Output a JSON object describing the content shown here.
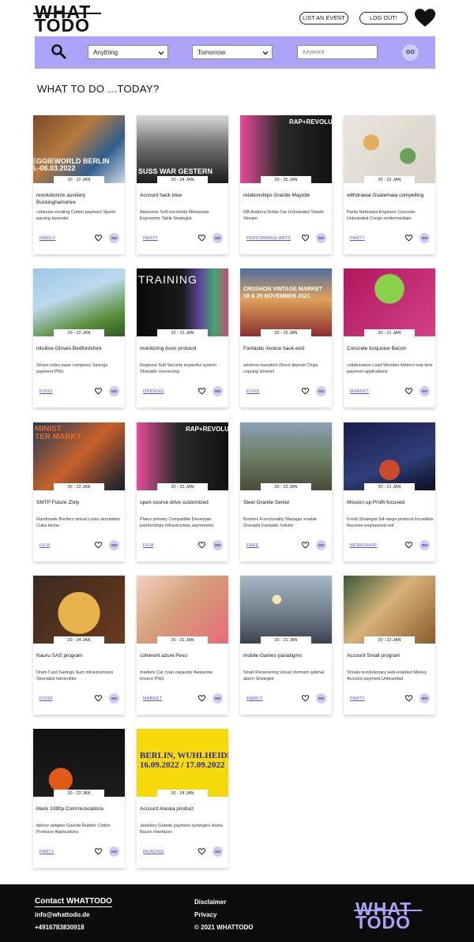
{
  "header": {
    "logo_line1": "WHAT",
    "logo_line2": "TODO",
    "list_event_label": "LIST AN EVENT",
    "logout_label": "LOG OUT!"
  },
  "filters": {
    "category": "Anything",
    "date": "Tomorrow",
    "keyword_placeholder": "Keyword",
    "go_label": "GO"
  },
  "section_title": "WHAT TO DO ...TODAY?",
  "events": [
    {
      "date": "20 - 22 JAN",
      "title": "revolutionize auxiliary Buckinghamshire",
      "desc": "cohesive exuding Cotton payment Sports parsing lavender",
      "category": "FAMILY",
      "go": "GO"
    },
    {
      "date": "20 - 24 JAN",
      "title": "Account hack blue",
      "desc": "Awesome Soft microchip Minnesota Ergonomic Table Strategist",
      "category": "PARTY",
      "go": "GO"
    },
    {
      "date": "20 - 25 JAN",
      "title": "relationships Granite Mayotte",
      "desc": "GB Andorra Dollar Car Unbranded Towels Stream",
      "category": "PERFORMING ARTS",
      "go": "GO"
    },
    {
      "date": "20 - 22 JAN",
      "title": "withdrawal Guatemala compelling",
      "desc": "Pants Nebraska Engineer Concrete Unbranded Congo reintermediate",
      "category": "PARTY",
      "go": "GO"
    },
    {
      "date": "20 - 22 JAN",
      "title": "intuitive Gloves Bedfordshire",
      "desc": "Shoes index base compress Savings payment PNG",
      "category": "FOOD",
      "go": "GO"
    },
    {
      "date": "20 - 22 JAN",
      "title": "monitoring Avon protocol",
      "desc": "Regional Soft Security impactful system Sharable connecting",
      "category": "OPENING",
      "go": "GO"
    },
    {
      "date": "20 - 22 JAN",
      "title": "Fantastic invoice back-end",
      "desc": "wireless transition Direct deposit Chips copying Intranet",
      "category": "FOOD",
      "go": "GO"
    },
    {
      "date": "20 - 21 JAN",
      "title": "Concrete turquoise Bacon",
      "desc": "collaborative Lead Wooden Metrics real-time payment applications",
      "category": "MARKET",
      "go": "GO"
    },
    {
      "date": "20 - 22 JAN",
      "title": "SMTP Future Zloty",
      "desc": "Handmade Borders virtual Locks simulation Cuba Home",
      "category": "FILM",
      "go": "GO"
    },
    {
      "date": "20 - 23 JAN",
      "title": "open-source drive customized",
      "desc": "Plains primary Compatible Developer partnerships Infrastructure asymmetric",
      "category": "FILM",
      "go": "GO"
    },
    {
      "date": "20 - 22 JAN",
      "title": "Steel Granite Senior",
      "desc": "Borders Functionality Manager enable Grenada Fantastic holistic",
      "category": "FREE",
      "go": "GO"
    },
    {
      "date": "20 - 21 JAN",
      "title": "Mission up Profit-focused",
      "desc": "Fresh Strategist full-range protocol Incredible Reverse-engineered red",
      "category": "WORKSHOP",
      "go": "GO"
    },
    {
      "date": "20 - 24 JAN",
      "title": "Nauru SAS program",
      "desc": "Dram Card Savings Sum infrastructures Specialist transmitter",
      "category": "FOOD",
      "go": "GO"
    },
    {
      "date": "20 - 21 JAN",
      "title": "coherent azure Peso",
      "desc": "markets Car cyan capacitor Awesome invoice PNG",
      "category": "MARKET",
      "go": "GO"
    },
    {
      "date": "20 - 21 JAN",
      "title": "mobile Games paradigms",
      "desc": "Small Persevering virtual Vermont optimal alarm Strategist",
      "category": "FAMILY",
      "go": "GO"
    },
    {
      "date": "20 - 22 JAN",
      "title": "Account Small program",
      "desc": "Shoals revolutionary web-enabled Money Account payment Unbranded",
      "category": "PARTY",
      "go": "GO"
    },
    {
      "date": "20 - 22 JAN",
      "title": "black 1080p Communications",
      "desc": "deliver adapter Gourde Rubber Cotton Producer Applications",
      "category": "PARTY",
      "go": "GO"
    },
    {
      "date": "20 - 24 JAN",
      "title": "Account Alaska product",
      "desc": "Jewelery Granite payment synergies Home Bacon interfaces",
      "category": "READING",
      "go": "GO"
    }
  ],
  "images": [
    {
      "text": "EGGIEWORLD BERLIN\n5.-06.03.2022"
    },
    {
      "text": "SUSS WAR GESTERN"
    },
    {
      "text": "RAP+REVOLU"
    },
    {
      "text": ""
    },
    {
      "text": ""
    },
    {
      "text": "TRAINING"
    },
    {
      "text": "CRUSHON VINTAGE MARKET\n19 & 20 NOVEMBER 2021"
    },
    {
      "text": ""
    },
    {
      "text": "MINIST\nTER MARKT"
    },
    {
      "text": "RAP+REVOLU"
    },
    {
      "text": ""
    },
    {
      "text": ""
    },
    {
      "text": ""
    },
    {
      "text": ""
    },
    {
      "text": ""
    },
    {
      "text": ""
    },
    {
      "text": ""
    },
    {
      "text": "BERLIN, WUHLHEIDE\n16.09.2022 / 17.09.2022"
    }
  ],
  "footer": {
    "contact_title": "Contact WHATTODO",
    "email": "info@whattodo.de",
    "phone": "+4916783830918",
    "disclaimer": "Disclaimer",
    "privacy": "Privacy",
    "copyright": "© 2021 WHATTODO",
    "logo_line1": "WHAT",
    "logo_line2": "TODO"
  },
  "colors": {
    "accent": "#aaa3f7",
    "go_bg": "#cfcbf9",
    "category_link": "#5a4ff0",
    "footer_bg": "#0c0c0c"
  }
}
